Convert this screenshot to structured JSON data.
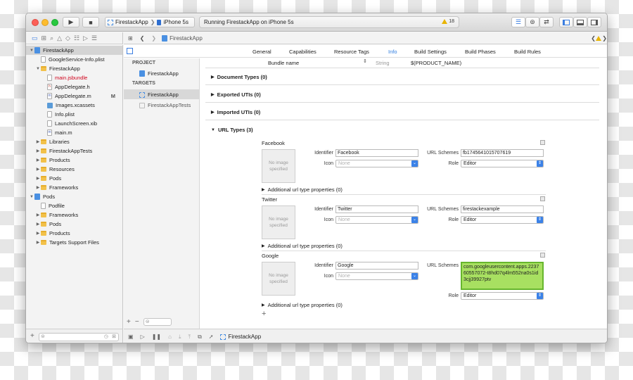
{
  "toolbar": {
    "scheme_target": "FirestackApp",
    "scheme_device": "iPhone 5s",
    "status_text": "Running FirestackApp on iPhone 5s",
    "warning_count": "18"
  },
  "navigator": {
    "items": [
      {
        "label": "FirestackApp",
        "type": "project",
        "disclosure": "▼"
      },
      {
        "label": "GoogleService-Info.plist",
        "type": "file",
        "disclosure": ""
      },
      {
        "label": "FirestackApp",
        "type": "folder",
        "disclosure": "▼"
      },
      {
        "label": "main.jsbundle",
        "type": "file",
        "disclosure": "",
        "color": "#d0021b"
      },
      {
        "label": "AppDelegate.h",
        "type": "h",
        "disclosure": ""
      },
      {
        "label": "AppDelegate.m",
        "type": "m",
        "disclosure": "",
        "badge": "M"
      },
      {
        "label": "Images.xcassets",
        "type": "assets",
        "disclosure": ""
      },
      {
        "label": "Info.plist",
        "type": "file",
        "disclosure": ""
      },
      {
        "label": "LaunchScreen.xib",
        "type": "file",
        "disclosure": ""
      },
      {
        "label": "main.m",
        "type": "m",
        "disclosure": ""
      },
      {
        "label": "Libraries",
        "type": "folder",
        "disclosure": "▶"
      },
      {
        "label": "FirestackAppTests",
        "type": "folder",
        "disclosure": "▶"
      },
      {
        "label": "Products",
        "type": "folder",
        "disclosure": "▶"
      },
      {
        "label": "Resources",
        "type": "folder",
        "disclosure": "▶"
      },
      {
        "label": "Pods",
        "type": "folder",
        "disclosure": "▶"
      },
      {
        "label": "Frameworks",
        "type": "folder",
        "disclosure": "▶"
      },
      {
        "label": "Pods",
        "type": "project",
        "disclosure": "▼"
      },
      {
        "label": "Podfile",
        "type": "file",
        "disclosure": ""
      },
      {
        "label": "Frameworks",
        "type": "folder",
        "disclosure": "▶"
      },
      {
        "label": "Pods",
        "type": "folder",
        "disclosure": "▶"
      },
      {
        "label": "Products",
        "type": "folder",
        "disclosure": "▶"
      },
      {
        "label": "Targets Support Files",
        "type": "folder",
        "disclosure": "▶"
      }
    ]
  },
  "jumpbar": {
    "file": "FirestackApp"
  },
  "targets_pane": {
    "project_header": "PROJECT",
    "project_item": "FirestackApp",
    "targets_header": "TARGETS",
    "targets": [
      "FirestackApp",
      "FirestackAppTests"
    ]
  },
  "tabs": [
    "General",
    "Capabilities",
    "Resource Tags",
    "Info",
    "Build Settings",
    "Build Phases",
    "Build Rules"
  ],
  "active_tab": "Info",
  "bundle_row": {
    "key": "Bundle name",
    "type": "String",
    "value": "$(PRODUCT_NAME)"
  },
  "sections": {
    "document_types": "Document Types (0)",
    "exported_utis": "Exported UTIs (0)",
    "imported_utis": "Imported UTIs (0)",
    "url_types": "URL Types (3)"
  },
  "labels": {
    "identifier": "Identifier",
    "icon": "Icon",
    "url_schemes": "URL Schemes",
    "role": "Role",
    "additional": "Additional url type properties (0)",
    "no_image": "No image specified",
    "icon_placeholder": "None"
  },
  "url_types": [
    {
      "name": "Facebook",
      "identifier": "Facebook",
      "url_schemes": "fb1745641015707619",
      "role": "Editor"
    },
    {
      "name": "Twitter",
      "identifier": "Twitter",
      "url_schemes": "firestackexample",
      "role": "Editor"
    },
    {
      "name": "Google",
      "identifier": "Google",
      "url_schemes": "com.googleusercontent.apps.223760557072-t8hd07q4lm552na0s1id3cjj39927ptv",
      "role": "Editor"
    }
  ],
  "bottom_bar": {
    "scheme": "FirestackApp"
  }
}
